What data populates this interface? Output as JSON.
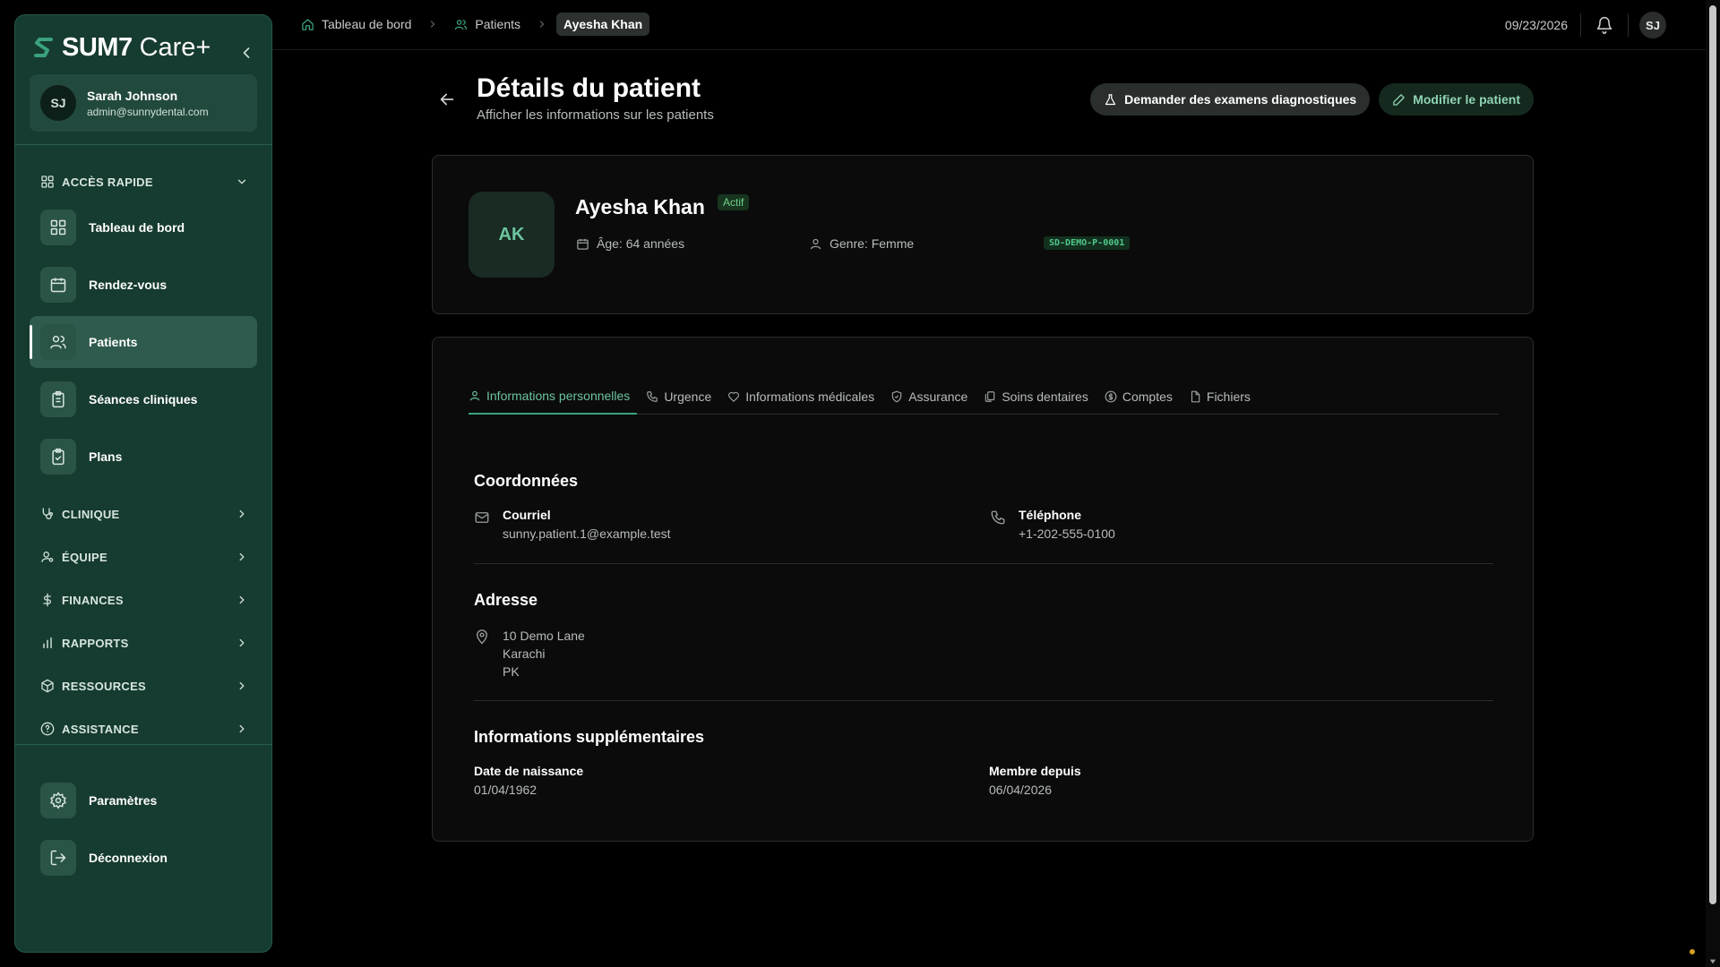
{
  "brand": {
    "name": "SUM7",
    "suffix": "Care+",
    "accent": "#3aa27e"
  },
  "user": {
    "initials": "SJ",
    "name": "Sarah Johnson",
    "email": "admin@sunnydental.com"
  },
  "sidebar": {
    "quick_access": "ACCÈS RAPIDE",
    "items": [
      {
        "label": "Tableau de bord",
        "icon": "grid-icon"
      },
      {
        "label": "Rendez-vous",
        "icon": "calendar-icon"
      },
      {
        "label": "Patients",
        "icon": "users-icon",
        "active": true
      },
      {
        "label": "Séances cliniques",
        "icon": "clipboard-icon"
      },
      {
        "label": "Plans",
        "icon": "clipboard-check-icon"
      }
    ],
    "sections": [
      {
        "label": "CLINIQUE",
        "icon": "stethoscope-icon"
      },
      {
        "label": "ÉQUIPE",
        "icon": "user-cog-icon"
      },
      {
        "label": "FINANCES",
        "icon": "dollar-icon"
      },
      {
        "label": "RAPPORTS",
        "icon": "bar-chart-icon"
      },
      {
        "label": "RESSOURCES",
        "icon": "box-icon"
      },
      {
        "label": "ASSISTANCE",
        "icon": "help-circle-icon"
      }
    ],
    "footer": [
      {
        "label": "Paramètres",
        "icon": "gear-icon"
      },
      {
        "label": "Déconnexion",
        "icon": "logout-icon"
      }
    ]
  },
  "breadcrumb": {
    "items": [
      "Tableau de bord",
      "Patients"
    ],
    "current": "Ayesha Khan"
  },
  "topbar": {
    "date": "09/23/2026",
    "avatar": "SJ"
  },
  "page": {
    "title": "Détails du patient",
    "subtitle": "Afficher les informations sur les patients",
    "request_exams": "Demander des examens diagnostiques",
    "edit_patient": "Modifier le patient"
  },
  "patient": {
    "initials": "AK",
    "name": "Ayesha Khan",
    "status": "Actif",
    "age": "Âge: 64 années",
    "gender": "Genre: Femme",
    "code": "SD-DEMO-P-0001"
  },
  "tabs": [
    {
      "label": "Informations personnelles",
      "icon": "user-icon",
      "active": true
    },
    {
      "label": "Urgence",
      "icon": "phone-icon"
    },
    {
      "label": "Informations médicales",
      "icon": "heart-icon"
    },
    {
      "label": "Assurance",
      "icon": "shield-icon"
    },
    {
      "label": "Soins dentaires",
      "icon": "copy-icon"
    },
    {
      "label": "Comptes",
      "icon": "coin-icon"
    },
    {
      "label": "Fichiers",
      "icon": "file-icon"
    }
  ],
  "contact": {
    "title": "Coordonnées",
    "email_label": "Courriel",
    "email": "sunny.patient.1@example.test",
    "phone_label": "Téléphone",
    "phone": "+1-202-555-0100"
  },
  "address": {
    "title": "Adresse",
    "lines": [
      "10 Demo Lane",
      "Karachi",
      "PK"
    ]
  },
  "extra": {
    "title": "Informations supplémentaires",
    "dob_label": "Date de naissance",
    "dob": "01/04/1962",
    "member_label": "Membre depuis",
    "member": "06/04/2026"
  }
}
